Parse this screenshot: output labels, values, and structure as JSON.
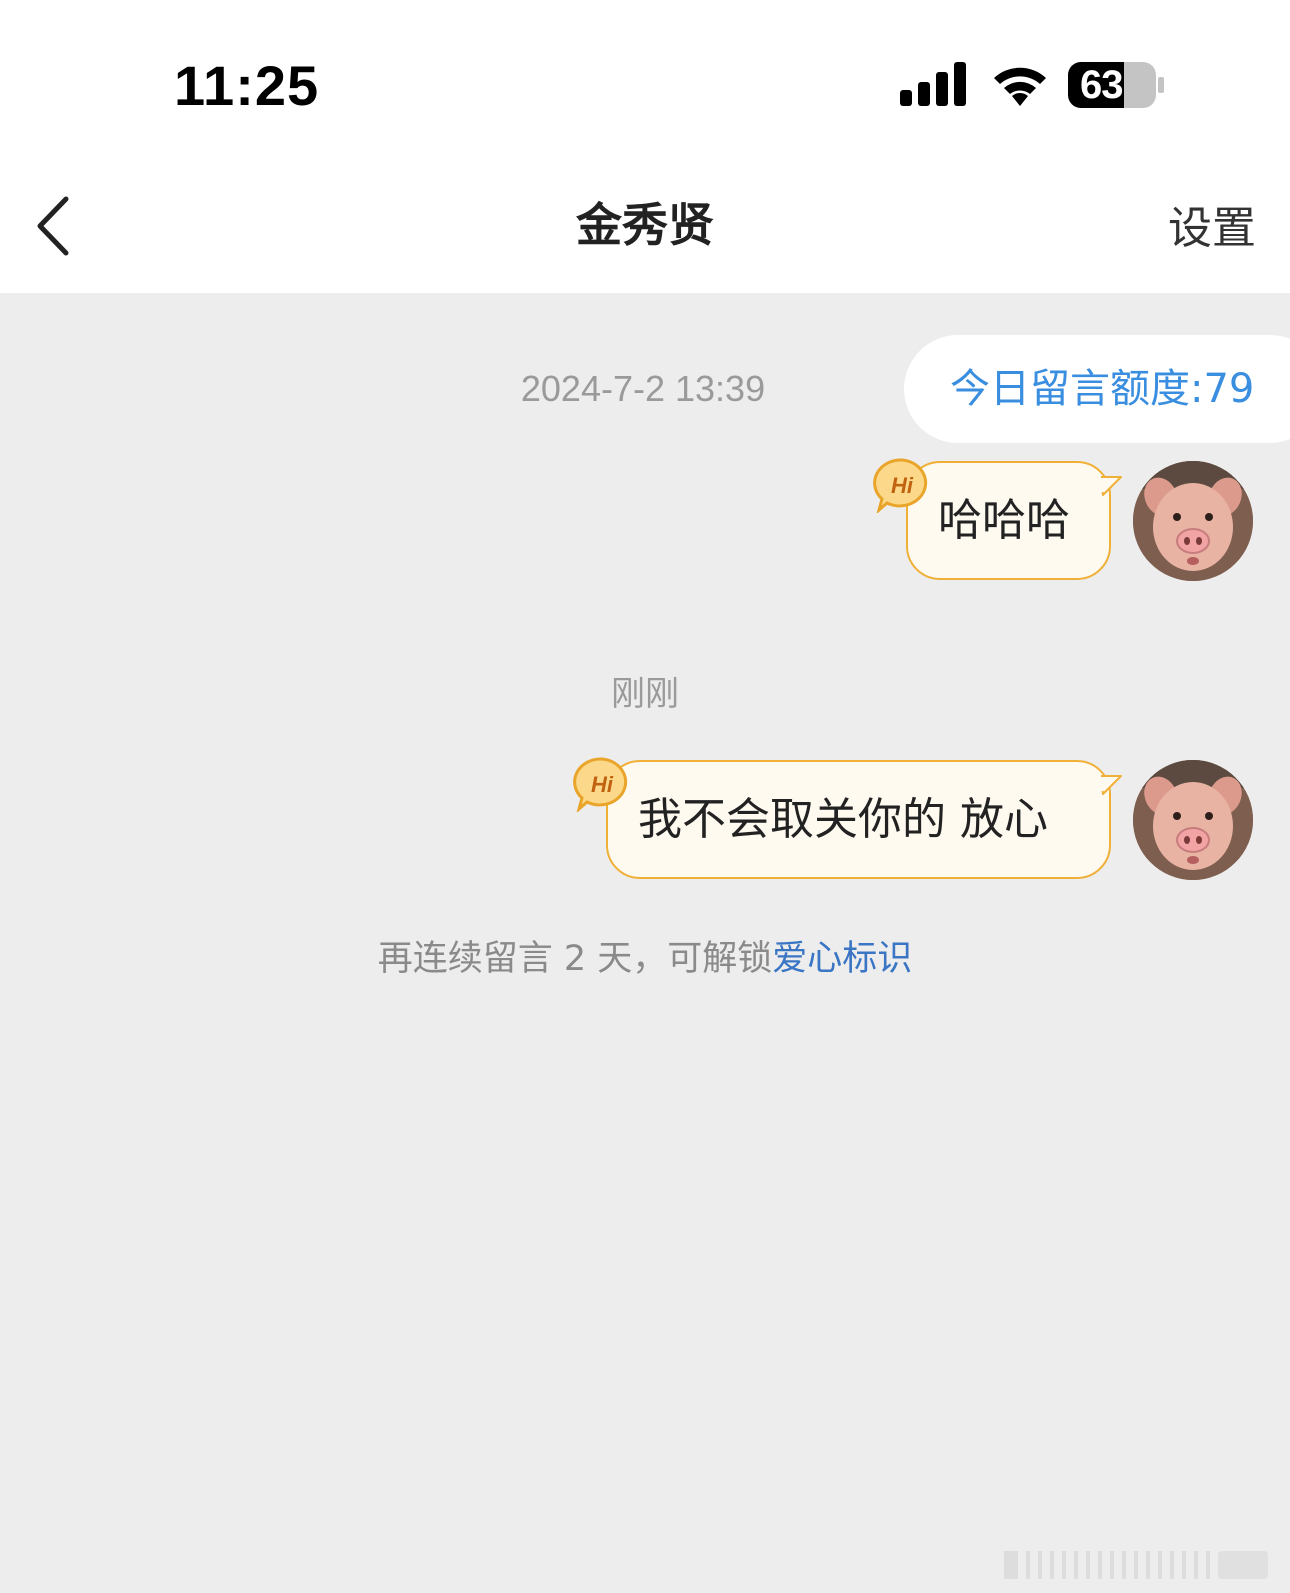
{
  "status_bar": {
    "time": "11:25",
    "battery_level": "63",
    "icons": [
      "signal-icon",
      "wifi-icon",
      "battery-icon"
    ]
  },
  "header": {
    "title": "金秀贤",
    "settings_label": "设置",
    "back_icon": "chevron-left-icon"
  },
  "quota": {
    "label": "今日留言额度:79",
    "color": "#3a8ee0"
  },
  "messages": [
    {
      "time": "2024-7-2 13:39",
      "text": "哈哈哈",
      "badge": "Hi"
    },
    {
      "time": "刚刚",
      "text": "我不会取关你的 放心",
      "badge": "Hi"
    }
  ],
  "unlock_hint": {
    "text": "再连续留言 2 天，可解锁",
    "link_text": "爱心标识",
    "link_color": "#3a76c4"
  },
  "colors": {
    "background": "#ededed",
    "bubble_fill": "#fffaf0",
    "bubble_border": "#f0b038"
  }
}
